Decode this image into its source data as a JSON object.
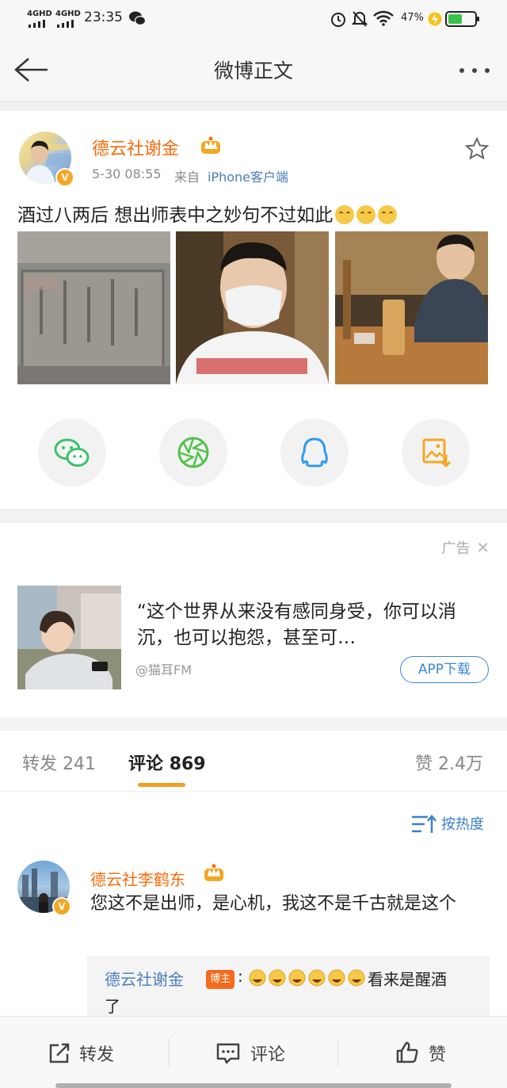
{
  "status_bar": {
    "network1": "4GHD",
    "network2": "4GHD",
    "time": "23:35",
    "battery": "47%"
  },
  "nav": {
    "title": "微博正文"
  },
  "post": {
    "author": "德云社谢金",
    "time": "5-30 08:55",
    "source_prefix": "来自",
    "source": "iPhone客户端",
    "text": "酒过八两后 想出师表中之妙句不过如此",
    "emoji_count": 3,
    "image_count": 3
  },
  "share": {
    "items": [
      "wechat-icon",
      "moments-icon",
      "qq-icon",
      "save-image-icon"
    ],
    "colors": {
      "wechat": "#3cc26a",
      "moments": "#52c24a",
      "qq": "#2f9cf0",
      "save": "#f5a623"
    }
  },
  "ad": {
    "label": "广告",
    "text": "“这个世界从来没有感同身受，你可以消沉，也可以抱怨，甚至可…",
    "source": "@猫耳FM",
    "button": "APP下载"
  },
  "tabs": {
    "reposts_label": "转发",
    "reposts_count": "241",
    "comments_label": "评论",
    "comments_count": "869",
    "likes_label": "赞",
    "likes_count": "2.4万",
    "sort_label": "按热度"
  },
  "comment": {
    "author": "德云社李鹤东",
    "text": "您这不是出师，是心机，我这不是千古就是这个",
    "reply_author": "德云社谢金",
    "reply_badge": "博主",
    "reply_colon": ":",
    "reply_emoji_count": 6,
    "reply_text": "看来是醒酒",
    "reply_text_cont": "了"
  },
  "bottom_bar": {
    "repost": "转发",
    "comment": "评论",
    "like": "赞"
  },
  "colors": {
    "accent_orange": "#f86c0a",
    "link_blue": "#4a7fb8",
    "tab_underline": "#f0a020",
    "vip_badge": "#f5a623"
  }
}
